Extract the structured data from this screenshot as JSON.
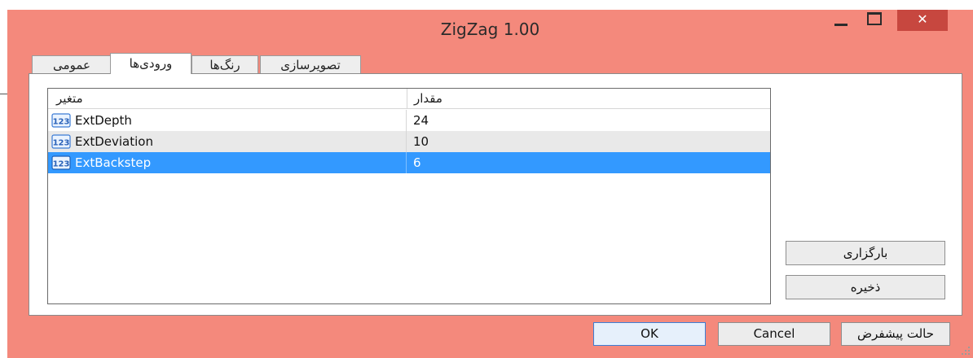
{
  "window": {
    "title": "ZigZag 1.00"
  },
  "titlebar_buttons": {
    "close_glyph": "✕"
  },
  "tabs": [
    {
      "label": "عمومی",
      "active": false
    },
    {
      "label": "ورودی‌ها",
      "active": true
    },
    {
      "label": "رنگ‌ها",
      "active": false
    },
    {
      "label": "تصویرسازی",
      "active": false
    }
  ],
  "inputs_table": {
    "headers": {
      "variable": "متغیر",
      "value": "مقدار"
    },
    "rows": [
      {
        "icon": "numeric-123-icon",
        "name": "ExtDepth",
        "value": "24",
        "state": "normal"
      },
      {
        "icon": "numeric-123-icon",
        "name": "ExtDeviation",
        "value": "10",
        "state": "alternate"
      },
      {
        "icon": "numeric-123-icon",
        "name": "ExtBackstep",
        "value": "6",
        "state": "selected"
      }
    ]
  },
  "side_buttons": {
    "load": "بارگزاری",
    "save": "ذخیره"
  },
  "footer_buttons": {
    "ok": "OK",
    "cancel": "Cancel",
    "reset": "حالت پیشفرض"
  },
  "colors": {
    "title_bar": "#f4897c",
    "close_button": "#c7473f",
    "selection": "#3399ff",
    "alt_row": "#e9e9e9"
  }
}
